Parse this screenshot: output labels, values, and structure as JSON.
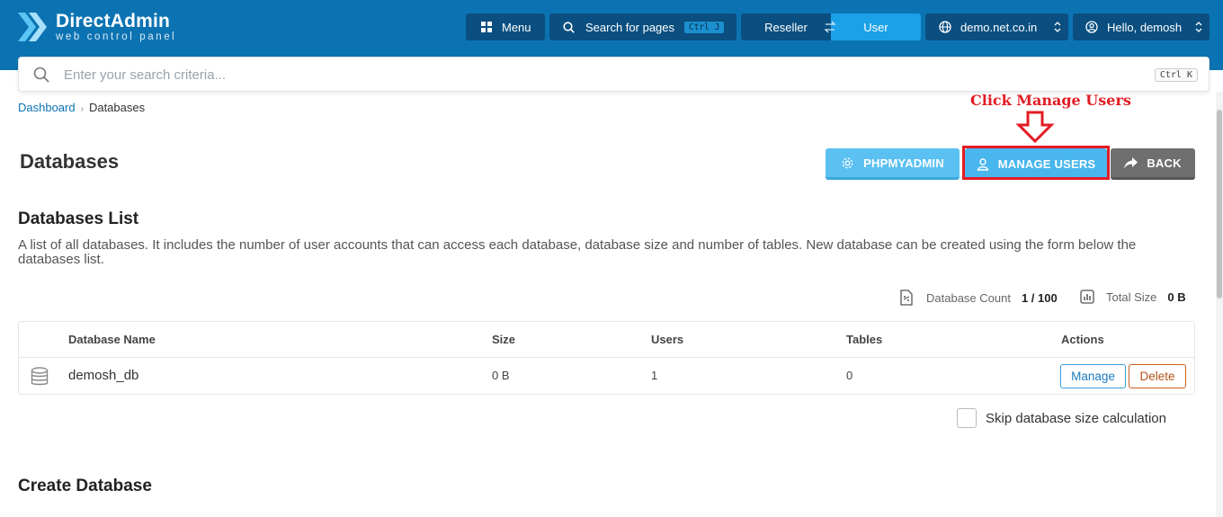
{
  "brand": {
    "title": "DirectAdmin",
    "subtitle": "web control panel"
  },
  "topnav": {
    "menu_label": "Menu",
    "search_label": "Search for pages",
    "search_shortcut": "Ctrl J",
    "reseller_label": "Reseller",
    "user_label": "User",
    "domain": "demo.net.co.in",
    "greeting": "Hello, demosh"
  },
  "search": {
    "placeholder": "Enter your search criteria...",
    "shortcut": "Ctrl K"
  },
  "breadcrumb": {
    "home": "Dashboard",
    "current": "Databases"
  },
  "page": {
    "title": "Databases"
  },
  "annotation": {
    "text": "Click Manage Users",
    "color": "#e31b23"
  },
  "actions": {
    "phpmyadmin": "PHPMYADMIN",
    "manage_users": "MANAGE USERS",
    "back": "BACK"
  },
  "list": {
    "title": "Databases List",
    "description": "A list of all databases. It includes the number of user accounts that can access each database, database size and number of tables. New database can be created using the form below the databases list.",
    "count_label": "Database Count",
    "count_value": "1 / 100",
    "size_label": "Total Size",
    "size_value": "0 B",
    "columns": [
      "Database Name",
      "Size",
      "Users",
      "Tables",
      "Actions"
    ],
    "rows": [
      {
        "name": "demosh_db",
        "size": "0 B",
        "users": "1",
        "tables": "0",
        "manage": "Manage",
        "delete": "Delete"
      }
    ]
  },
  "skip_label": "Skip database size calculation",
  "create": {
    "title": "Create Database"
  },
  "colors": {
    "header": "#0c73b3",
    "header_dark": "#0a4f80",
    "primary": "#49b6ee",
    "back": "#6f6f6f"
  }
}
